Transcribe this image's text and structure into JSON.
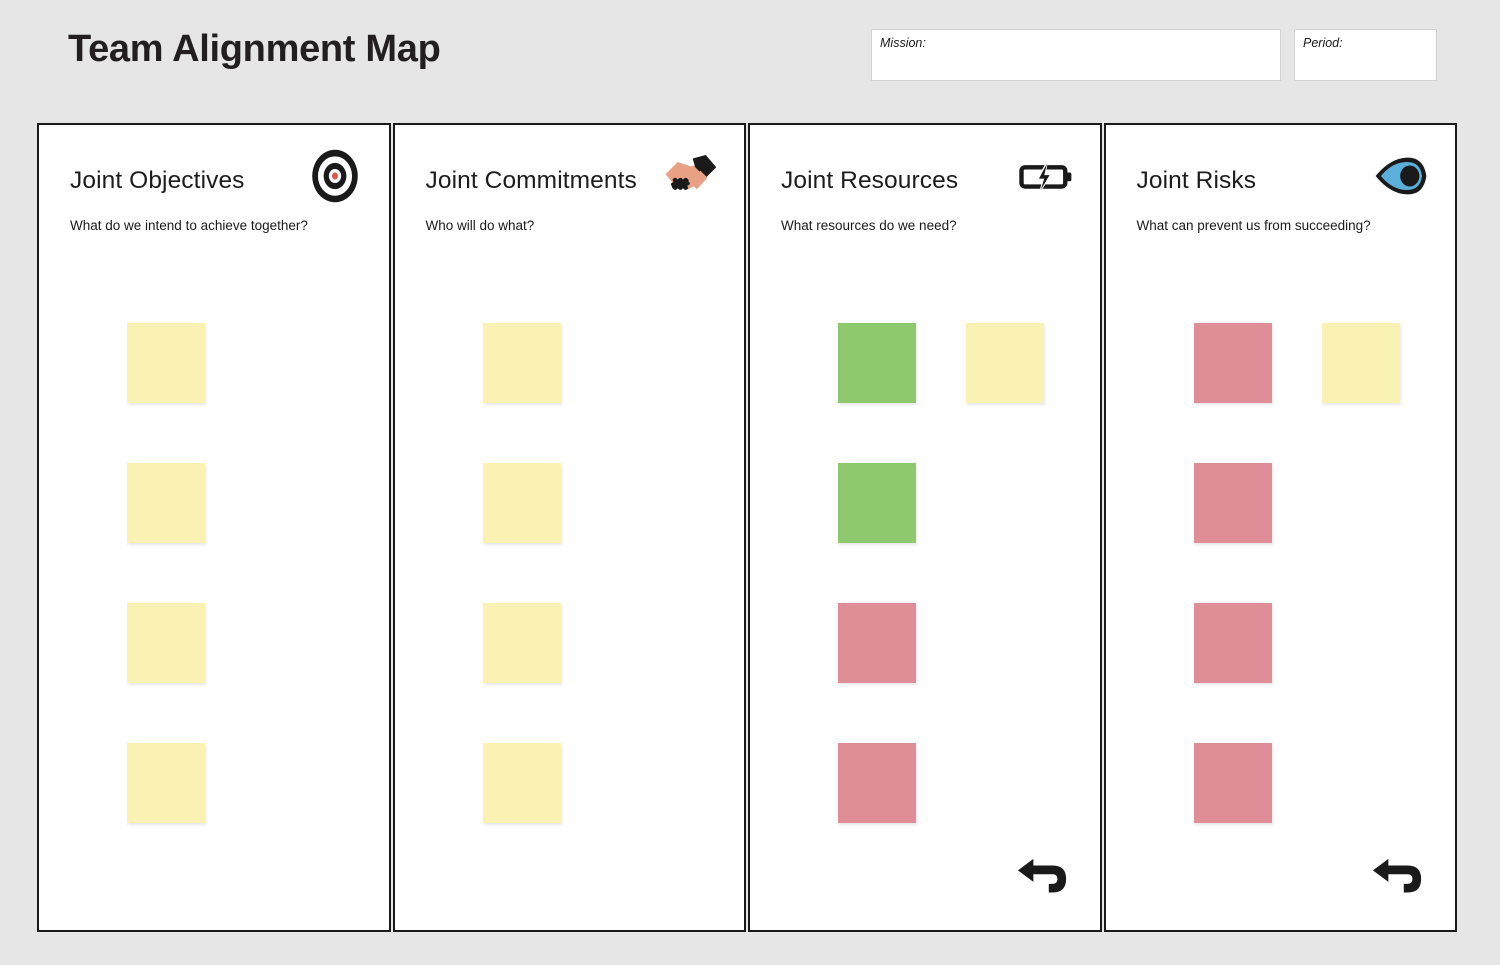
{
  "header": {
    "title": "Team Alignment Map",
    "mission": {
      "label": "Mission:",
      "value": "",
      "placeholder": ""
    },
    "period": {
      "label": "Period:",
      "value": "",
      "placeholder": ""
    }
  },
  "colors": {
    "background": "#e6e6e6",
    "panel_background": "#ffffff",
    "panel_border": "#1a1a1a",
    "note_yellow": "#faf2b2",
    "note_green": "#8ec96e",
    "note_red": "#df8d97",
    "title_text": "#231f20"
  },
  "columns": [
    {
      "title": "Joint Objectives",
      "subtitle": "What do we intend to achieve together?",
      "icon": "bullseye-target-icon",
      "has_return_arrow": false,
      "notes": [
        {
          "color": "yellow",
          "col": 0,
          "row": 0,
          "text": ""
        },
        {
          "color": "yellow",
          "col": 0,
          "row": 1,
          "text": ""
        },
        {
          "color": "yellow",
          "col": 0,
          "row": 2,
          "text": ""
        },
        {
          "color": "yellow",
          "col": 0,
          "row": 3,
          "text": ""
        }
      ]
    },
    {
      "title": "Joint Commitments",
      "subtitle": "Who will do what?",
      "icon": "handshake-icon",
      "has_return_arrow": false,
      "notes": [
        {
          "color": "yellow",
          "col": 0,
          "row": 0,
          "text": ""
        },
        {
          "color": "yellow",
          "col": 0,
          "row": 1,
          "text": ""
        },
        {
          "color": "yellow",
          "col": 0,
          "row": 2,
          "text": ""
        },
        {
          "color": "yellow",
          "col": 0,
          "row": 3,
          "text": ""
        }
      ]
    },
    {
      "title": "Joint Resources",
      "subtitle": "What resources do we need?",
      "icon": "charging-battery-icon",
      "has_return_arrow": true,
      "return_arrow_icon": "leftwards-arrow-with-hook-icon",
      "notes": [
        {
          "color": "green",
          "col": 0,
          "row": 0,
          "text": ""
        },
        {
          "color": "yellow",
          "col": 1,
          "row": 0,
          "text": ""
        },
        {
          "color": "green",
          "col": 0,
          "row": 1,
          "text": ""
        },
        {
          "color": "red",
          "col": 0,
          "row": 2,
          "text": ""
        },
        {
          "color": "red",
          "col": 0,
          "row": 3,
          "text": ""
        }
      ]
    },
    {
      "title": "Joint Risks",
      "subtitle": "What can prevent us from succeeding?",
      "icon": "eye-icon",
      "has_return_arrow": true,
      "return_arrow_icon": "leftwards-arrow-with-hook-icon",
      "notes": [
        {
          "color": "red",
          "col": 0,
          "row": 0,
          "text": ""
        },
        {
          "color": "yellow",
          "col": 1,
          "row": 0,
          "text": ""
        },
        {
          "color": "red",
          "col": 0,
          "row": 1,
          "text": ""
        },
        {
          "color": "red",
          "col": 0,
          "row": 2,
          "text": ""
        },
        {
          "color": "red",
          "col": 0,
          "row": 3,
          "text": ""
        }
      ]
    }
  ]
}
